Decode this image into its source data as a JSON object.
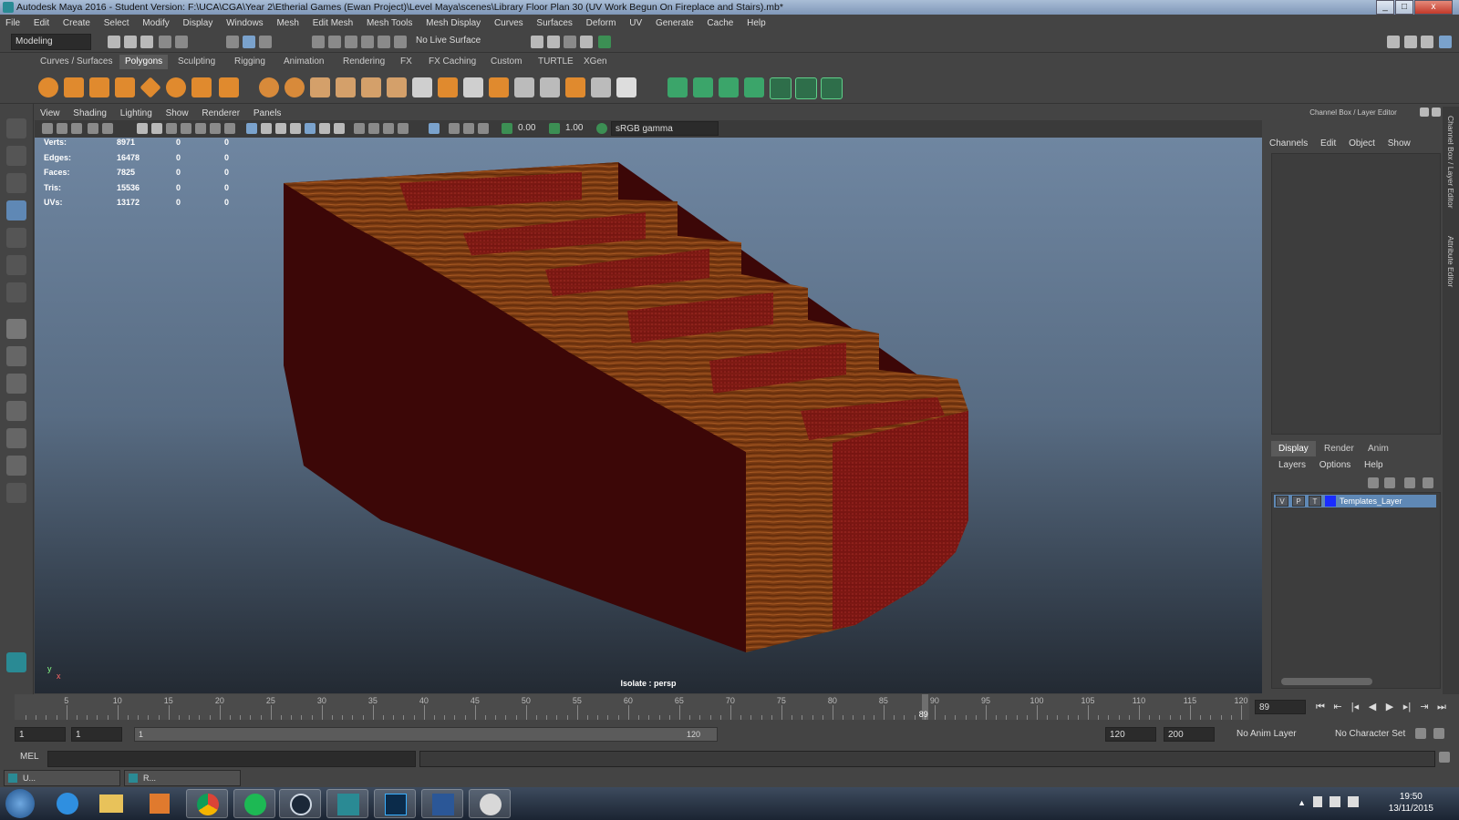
{
  "window": {
    "title": "Autodesk Maya 2016 - Student Version: F:\\UCA\\CGA\\Year 2\\Etherial Games (Ewan Project)\\Level Maya\\scenes\\Library Floor Plan 30 (UV Work Begun On Fireplace and Stairs).mb*",
    "minimize": "_",
    "maximize": "□",
    "close": "x"
  },
  "menubar": [
    "File",
    "Edit",
    "Create",
    "Select",
    "Modify",
    "Display",
    "Windows",
    "Mesh",
    "Edit Mesh",
    "Mesh Tools",
    "Mesh Display",
    "Curves",
    "Surfaces",
    "Deform",
    "UV",
    "Generate",
    "Cache",
    "Help"
  ],
  "statusline": {
    "mode": "Modeling",
    "live_surface": "No Live Surface"
  },
  "shelf_tabs": [
    "Curves / Surfaces",
    "Polygons",
    "Sculpting",
    "Rigging",
    "Animation",
    "Rendering",
    "FX",
    "FX Caching",
    "Custom",
    "TURTLE",
    "XGen"
  ],
  "shelf_active": "Polygons",
  "panel_menu": [
    "View",
    "Shading",
    "Lighting",
    "Show",
    "Renderer",
    "Panels"
  ],
  "panel_toolbar": {
    "exposure": "0.00",
    "gamma": "1.00",
    "color_space": "sRGB gamma"
  },
  "hud": [
    {
      "label": "Verts:",
      "v1": "8971",
      "v2": "0",
      "v3": "0"
    },
    {
      "label": "Edges:",
      "v1": "16478",
      "v2": "0",
      "v3": "0"
    },
    {
      "label": "Faces:",
      "v1": "7825",
      "v2": "0",
      "v3": "0"
    },
    {
      "label": "Tris:",
      "v1": "15536",
      "v2": "0",
      "v3": "0"
    },
    {
      "label": "UVs:",
      "v1": "13172",
      "v2": "0",
      "v3": "0"
    }
  ],
  "viewport_label": "Isolate : persp",
  "axis": {
    "y": "y",
    "x": "x"
  },
  "channel_box": {
    "title": "Channel Box / Layer Editor",
    "menu": [
      "Channels",
      "Edit",
      "Object",
      "Show"
    ]
  },
  "side_tabs": [
    "Channel Box / Layer Editor",
    "Attribute Editor"
  ],
  "layer_editor": {
    "tabs": [
      "Display",
      "Render",
      "Anim"
    ],
    "active_tab": "Display",
    "menu": [
      "Layers",
      "Options",
      "Help"
    ],
    "layer": {
      "v": "V",
      "p": "P",
      "t": "T",
      "name": "Templates_Layer",
      "color": "#1a2cff"
    }
  },
  "timeline": {
    "ticks": [
      "5",
      "10",
      "15",
      "20",
      "25",
      "30",
      "35",
      "40",
      "45",
      "50",
      "55",
      "60",
      "65",
      "70",
      "75",
      "80",
      "85",
      "90",
      "95",
      "100",
      "105",
      "110",
      "115",
      "120"
    ],
    "current_frame_marker": "89",
    "current_frame_field": "89"
  },
  "range": {
    "start_field": "1",
    "playback_start": "1",
    "slider_start": "1",
    "slider_end": "120",
    "playback_end": "120",
    "end_field": "200",
    "anim_layer": "No Anim Layer",
    "character_set": "No Character Set"
  },
  "command_line": {
    "label": "MEL"
  },
  "mini_windows": [
    {
      "label": "U..."
    },
    {
      "label": "R..."
    }
  ],
  "taskbar": {
    "time": "19:50",
    "date": "13/11/2015"
  }
}
